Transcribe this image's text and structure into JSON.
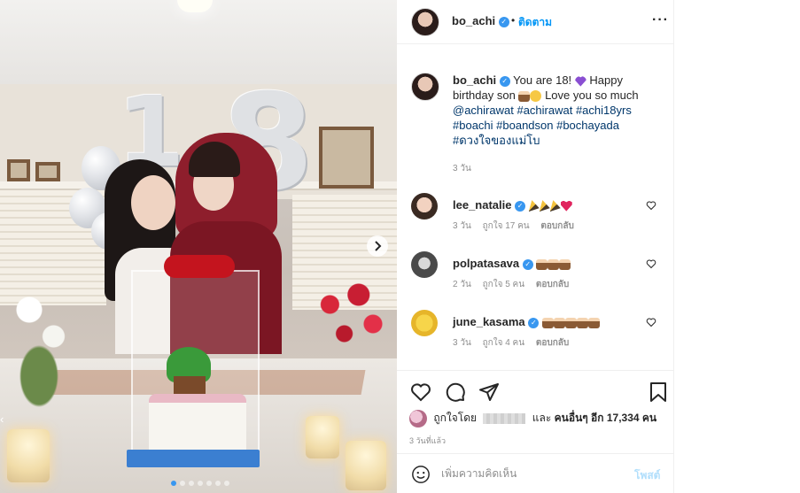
{
  "post": {
    "username": "bo_achi",
    "verified": true,
    "follow_label": "ติดตาม",
    "more_icon": "more-horizontal-icon",
    "balloon_digit_1": "1",
    "balloon_digit_8": "8",
    "slide_count": 7,
    "active_slide": 1
  },
  "caption": {
    "username": "bo_achi",
    "text_1": "You are 18!",
    "text_2": "Happy birthday son",
    "text_3": "Love you so much",
    "mention": "@achirawat",
    "tags_line1": "#achirawat #achi18yrs",
    "tags_line2": "#boachi #boandson #bochayada",
    "tags_line3": "#ดวงใจของแม่โบ",
    "time": "3 วัน"
  },
  "comments": [
    {
      "username": "lee_natalie",
      "verified": true,
      "emojis": [
        "party",
        "party",
        "party",
        "heart-red"
      ],
      "time": "3 วัน",
      "likes": "ถูกใจ 17 คน",
      "reply": "ตอบกลับ"
    },
    {
      "username": "polpatasava",
      "verified": true,
      "emojis": [
        "cake",
        "cake",
        "cake"
      ],
      "time": "2 วัน",
      "likes": "ถูกใจ 5 คน",
      "reply": "ตอบกลับ"
    },
    {
      "username": "june_kasama",
      "verified": true,
      "emojis": [
        "cake",
        "cake",
        "cake",
        "cake",
        "cake"
      ],
      "time": "3 วัน",
      "likes": "ถูกใจ 4 คน",
      "reply": "ตอบกลับ"
    }
  ],
  "likes": {
    "prefix": "ถูกใจโดย",
    "middle": "และ",
    "suffix": "คนอื่นๆ อีก 17,334 คน"
  },
  "post_time": "3 วันที่แล้ว",
  "add_comment": {
    "placeholder": "เพิ่มความคิดเห็น",
    "post_label": "โพสต์"
  },
  "colors": {
    "link": "#0095f6",
    "hashtag": "#00376b",
    "verified": "#3897f0",
    "muted": "#8e8e8e"
  }
}
